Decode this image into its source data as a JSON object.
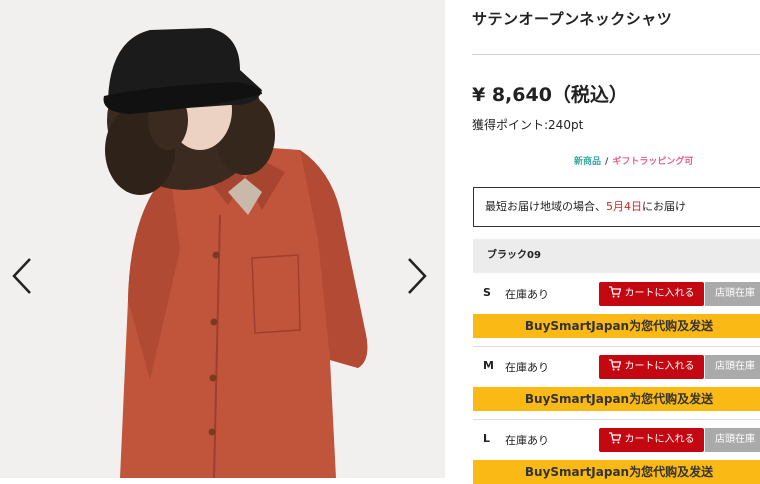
{
  "product": {
    "title": "サテンオープンネックシャツ",
    "price": "¥ 8,640（税込）",
    "points": "獲得ポイント:240pt",
    "tag_new": "新商品",
    "tag_sep": "/",
    "tag_gift": "ギフトラッピング可"
  },
  "delivery": {
    "prefix": "最短お届け地域の場合、",
    "date": "5月4日",
    "suffix": "にお届け"
  },
  "color_label": "ブラック09",
  "sizes": [
    {
      "size": "S",
      "stock": "在庫あり",
      "cart": "カートに入れる",
      "store": "店頭在庫",
      "buy": "BuySmartJapan为您代购及发送"
    },
    {
      "size": "M",
      "stock": "在庫あり",
      "cart": "カートに入れる",
      "store": "店頭在庫",
      "buy": "BuySmartJapan为您代购及发送"
    },
    {
      "size": "L",
      "stock": "在庫あり",
      "cart": "カートに入れる",
      "store": "店頭在庫",
      "buy": "BuySmartJapan为您代购及发送"
    }
  ],
  "colors": {
    "accent_red": "#c40812",
    "buy_yellow": "#fab914",
    "tag_new": "#3aa8a0",
    "tag_gift": "#e2608d",
    "shirt": "#c0553b"
  },
  "icons": {
    "prev": "chevron-left-icon",
    "next": "chevron-right-icon",
    "cart": "cart-icon"
  }
}
